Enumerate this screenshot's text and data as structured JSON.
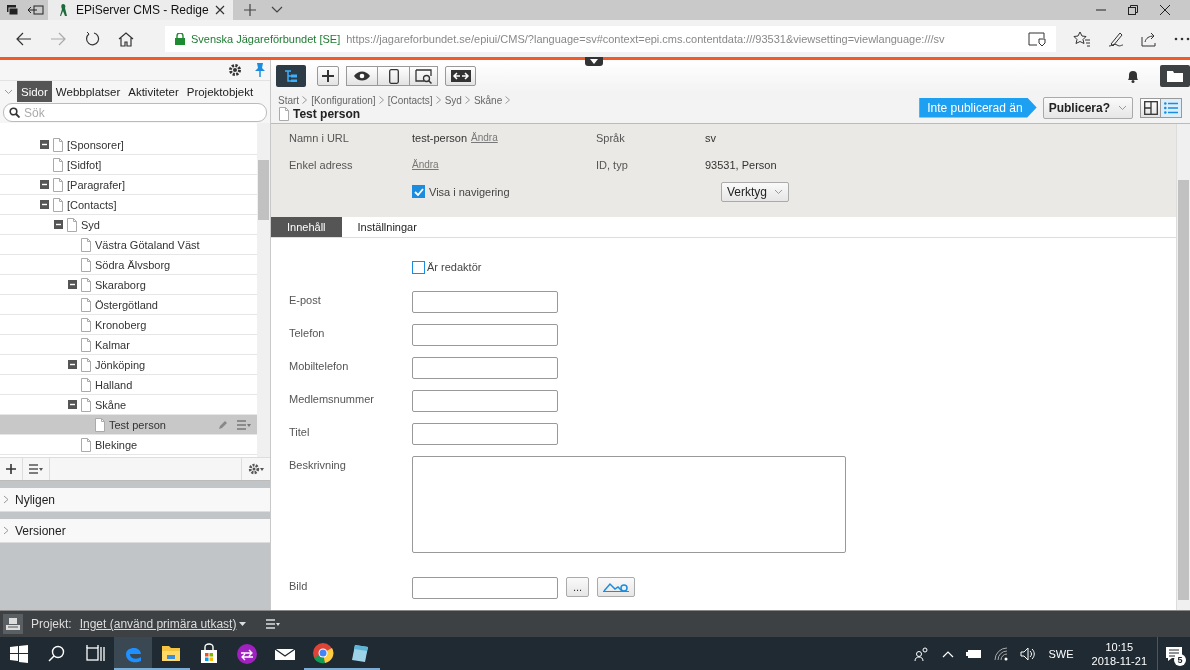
{
  "browser": {
    "tab_title": "EPiServer CMS - Redige",
    "site_identity": "Svenska Jägareförbundet [SE]",
    "url": "https://jagareforbundet.se/epiui/CMS/?language=sv#context=epi.cms.contentdata:///93531&viewsetting=viewlanguage:///sv"
  },
  "navigation_pane": {
    "tabs": [
      {
        "label": "Sidor",
        "selected": true
      },
      {
        "label": "Webbplatser",
        "selected": false
      },
      {
        "label": "Aktiviteter",
        "selected": false
      },
      {
        "label": "Projektobjekt",
        "selected": false
      }
    ],
    "search": {
      "placeholder": "Sök"
    },
    "tree": [
      {
        "label": "[Sponsorer]",
        "expanded": true,
        "selected": false
      },
      {
        "label": "[Sidfot]",
        "selected": false
      },
      {
        "label": "[Paragrafer]",
        "expanded": true,
        "selected": false
      },
      {
        "label": "[Contacts]",
        "expanded": true,
        "selected": false,
        "children": [
          {
            "label": "Syd",
            "expanded": true,
            "selected": false,
            "children": [
              {
                "label": "Västra Götaland Väst",
                "selected": false
              },
              {
                "label": "Södra Älvsborg",
                "selected": false
              },
              {
                "label": "Skaraborg",
                "expanded": true,
                "selected": false
              },
              {
                "label": "Östergötland",
                "selected": false
              },
              {
                "label": "Kronoberg",
                "selected": false
              },
              {
                "label": "Kalmar",
                "selected": false
              },
              {
                "label": "Jönköping",
                "expanded": true,
                "selected": false
              },
              {
                "label": "Halland",
                "selected": false
              },
              {
                "label": "Skåne",
                "expanded": true,
                "selected": false,
                "children": [
                  {
                    "label": "Test person",
                    "selected": true
                  }
                ]
              },
              {
                "label": "Blekinge",
                "selected": false
              }
            ]
          }
        ]
      }
    ]
  },
  "gadgets": [
    {
      "label": "Nyligen",
      "expanded": false
    },
    {
      "label": "Versioner",
      "expanded": false
    }
  ],
  "editor": {
    "breadcrumb": [
      "Start",
      "[Konfiguration]",
      "[Contacts]",
      "Syd",
      "Skåne"
    ],
    "title": "Test person",
    "status": "Inte publicerad än",
    "publish_button": "Publicera?",
    "properties": [
      {
        "label": "Namn i URL",
        "value": "test-person",
        "link": "Ändra"
      },
      {
        "label": "Språk",
        "value": "sv"
      },
      {
        "label": "Enkel adress",
        "link": "Ändra"
      },
      {
        "label": "ID, typ",
        "value": "93531, Person"
      }
    ],
    "visible_in_navigation": {
      "label": "Visa i navigering",
      "checked": true
    },
    "tools_button": "Verktyg",
    "tabs": [
      {
        "label": "Innehåll",
        "selected": true
      },
      {
        "label": "Inställningar",
        "selected": false
      }
    ],
    "fields": [
      {
        "kind": "checkbox",
        "label": "Är redaktör",
        "checked": false
      },
      {
        "kind": "text",
        "label": "E-post"
      },
      {
        "kind": "text",
        "label": "Telefon"
      },
      {
        "kind": "text",
        "label": "Mobiltelefon"
      },
      {
        "kind": "text",
        "label": "Medlemsnummer"
      },
      {
        "kind": "text",
        "label": "Titel"
      },
      {
        "kind": "textarea",
        "label": "Beskrivning"
      },
      {
        "kind": "image",
        "label": "Bild",
        "browse": "..."
      }
    ]
  },
  "project_bar": {
    "label": "Projekt:",
    "project": "Inget (använd primära utkast)"
  },
  "taskbar": {
    "language": "SWE",
    "time": "10:15",
    "date": "2018-11-21",
    "notifications": "5"
  }
}
